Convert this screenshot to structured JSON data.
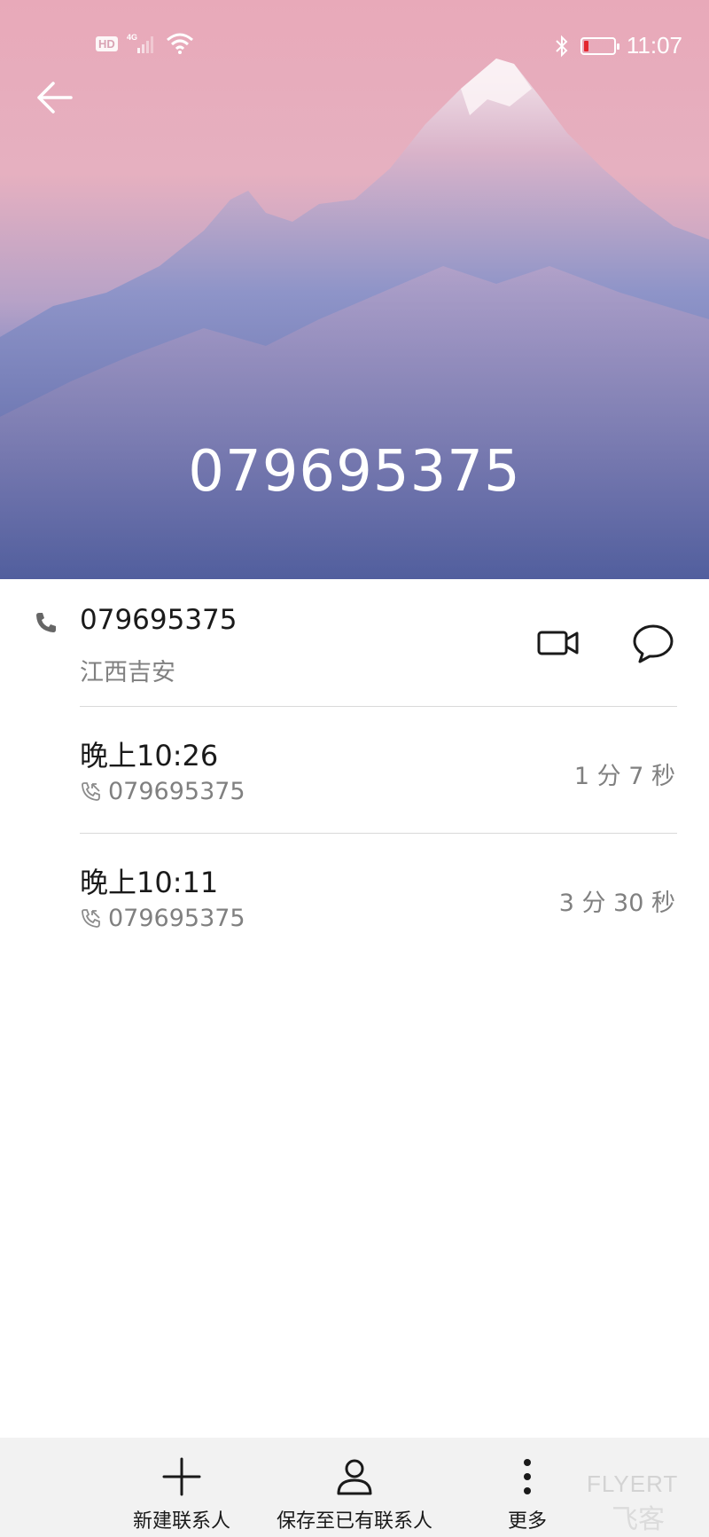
{
  "status_bar": {
    "network_badge": "HD",
    "network_type": "4G",
    "time": "11:07",
    "battery_color": "#e3262f"
  },
  "header": {
    "phone_number": "079695375",
    "back_icon": "arrow-left-icon"
  },
  "number_info": {
    "number": "079695375",
    "location": "江西吉安",
    "icons": [
      "phone-icon",
      "video-call-icon",
      "message-icon"
    ]
  },
  "call_records": [
    {
      "time": "晚上10:26",
      "number": "079695375",
      "duration": "1 分 7 秒",
      "icon": "incoming-call-icon"
    },
    {
      "time": "晚上10:11",
      "number": "079695375",
      "duration": "3 分 30 秒",
      "icon": "incoming-call-icon"
    }
  ],
  "toolbar": {
    "new_contact": "新建联系人",
    "save_existing": "保存至已有联系人",
    "more": "更多"
  },
  "watermark": {
    "brand": "FLYERT",
    "brand_cn": "飞客"
  },
  "colors": {
    "header_top": "#e8a9b9",
    "header_bottom": "#4e5b9e",
    "secondary_text": "#808080",
    "toolbar_bg": "#f2f2f2"
  }
}
